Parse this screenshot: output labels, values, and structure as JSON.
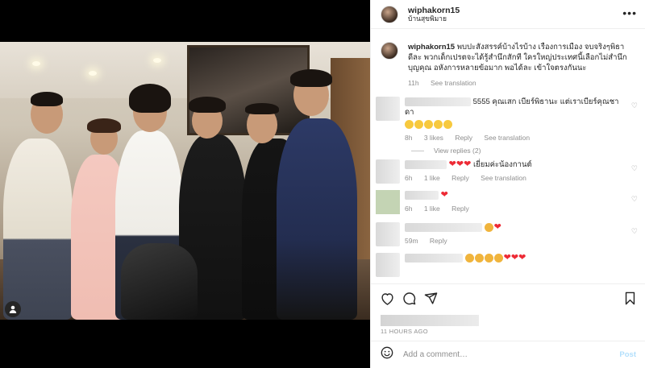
{
  "post": {
    "username": "wiphakorn15",
    "location": "บ้านสุขพิมาย"
  },
  "caption": {
    "username": "wiphakorn15",
    "text": "พบปะสังสรรค์บ้างไรบ้าง เรื่องการเมือง จบจริงๆพิธา ดีละ พวกเด็กเปรตจะได้รู้สำนึกสักที ใครใหญ่ประเทศนี้เลือกไม่สำนึกบุญคุณ อหังการหลายข้อมาก พอได้ละ เข้าใจตรงกันนะ",
    "time": "11h",
    "see_translation": "See translation"
  },
  "comments": [
    {
      "text": "5555 คุณเสก เบียร์พิธานะ แต่เราเบียร์คุณชาดา",
      "emoji_count": 5,
      "time": "8h",
      "likes": "3 likes",
      "reply": "Reply",
      "see_translation": "See translation"
    },
    {
      "view_replies": "View replies (2)"
    },
    {
      "text": "เยี่ยมค่ะน้องกานต์",
      "hearts": 3,
      "time": "6h",
      "likes": "1 like",
      "reply": "Reply",
      "see_translation": "See translation"
    },
    {
      "hearts": 1,
      "time": "6h",
      "likes": "1 like",
      "reply": "Reply"
    },
    {
      "time": "59m",
      "reply": "Reply"
    }
  ],
  "actions": {
    "timestamp": "11 HOURS AGO"
  },
  "add_comment": {
    "placeholder": "Add a comment…",
    "post_label": "Post"
  },
  "colors": {
    "accent_disabled": "#b2dffc",
    "meta_gray": "#8e8e8e",
    "heart_red": "#ed2a35"
  },
  "icons": [
    "more-options-icon",
    "heart-icon",
    "comment-icon",
    "share-icon",
    "bookmark-icon",
    "emoji-icon",
    "user-tag-icon"
  ]
}
